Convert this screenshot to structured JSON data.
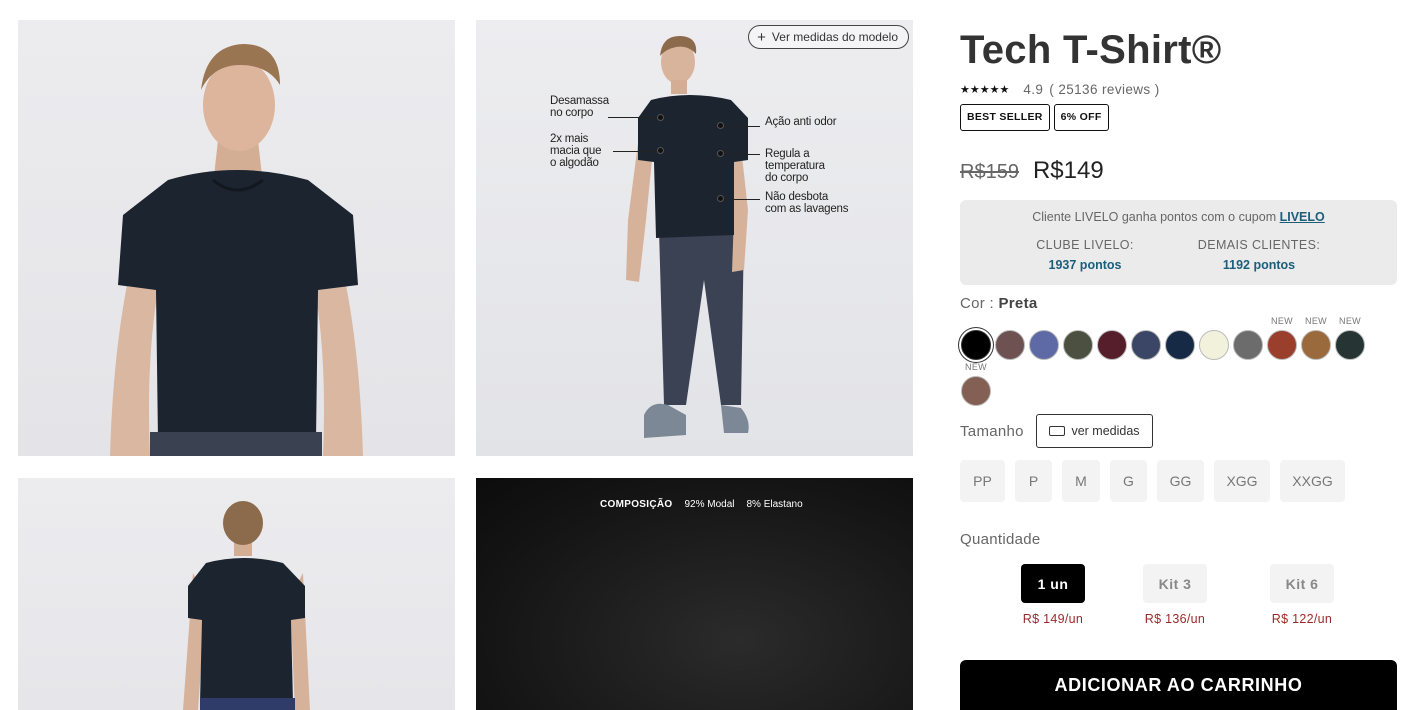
{
  "gallery": {
    "measure_button": "Ver medidas do modelo",
    "annotations": {
      "desamassa": "Desamassa\nno corpo",
      "macia": "2x mais\nmacia que\no algodão",
      "odor": "Ação anti odor",
      "regula": "Regula a\ntemperatura\ndo corpo",
      "desbota": "Não desbota\ncom as lavagens"
    },
    "composition": {
      "label": "COMPOSIÇÃO",
      "modal": "92% Modal",
      "elastano": "8% Elastano"
    }
  },
  "product": {
    "title": "Tech T-Shirt®",
    "stars": "★★★★★",
    "rating": "4.9",
    "reviews": "( 25136 reviews )",
    "badges": [
      "BEST SELLER",
      "6% OFF"
    ],
    "old_price": "R$159",
    "price": "R$149"
  },
  "livelo": {
    "text": "Cliente LIVELO ganha pontos com o cupom",
    "link": "LIVELO",
    "clube_label": "CLUBE LIVELO:",
    "clube_value": "1937 pontos",
    "demais_label": "DEMAIS CLIENTES:",
    "demais_value": "1192 pontos"
  },
  "color": {
    "label": "Cor : ",
    "selected": "Preta",
    "new_label": "NEW",
    "swatches": [
      {
        "name": "preta",
        "hex": "#000000",
        "new": false
      },
      {
        "name": "marrom-rosado",
        "hex": "#6e5252",
        "new": false
      },
      {
        "name": "azul-lavanda",
        "hex": "#5e6aa6",
        "new": false
      },
      {
        "name": "verde-oliva",
        "hex": "#4b5040",
        "new": false
      },
      {
        "name": "vinho",
        "hex": "#561d2b",
        "new": false
      },
      {
        "name": "azul-ardosia",
        "hex": "#3b4666",
        "new": false
      },
      {
        "name": "azul-marinho",
        "hex": "#162a45",
        "new": false
      },
      {
        "name": "off-white",
        "hex": "#f2f2dc",
        "new": false
      },
      {
        "name": "cinza",
        "hex": "#6c6c6c",
        "new": false
      },
      {
        "name": "terracota",
        "hex": "#9a3f2c",
        "new": true
      },
      {
        "name": "caramelo",
        "hex": "#9a6a3c",
        "new": true
      },
      {
        "name": "verde-escuro",
        "hex": "#263534",
        "new": true
      },
      {
        "name": "marrom-claro",
        "hex": "#835f54",
        "new": true
      }
    ]
  },
  "size": {
    "label": "Tamanho",
    "guide_button": "ver medidas",
    "options": [
      "PP",
      "P",
      "M",
      "G",
      "GG",
      "XGG",
      "XXGG"
    ]
  },
  "quantity": {
    "label": "Quantidade",
    "options": [
      {
        "label": "1 un",
        "price": "R$ 149/un",
        "selected": true
      },
      {
        "label": "Kit 3",
        "price": "R$ 136/un",
        "selected": false
      },
      {
        "label": "Kit 6",
        "price": "R$ 122/un",
        "selected": false
      }
    ]
  },
  "cart_button": "ADICIONAR AO CARRINHO"
}
